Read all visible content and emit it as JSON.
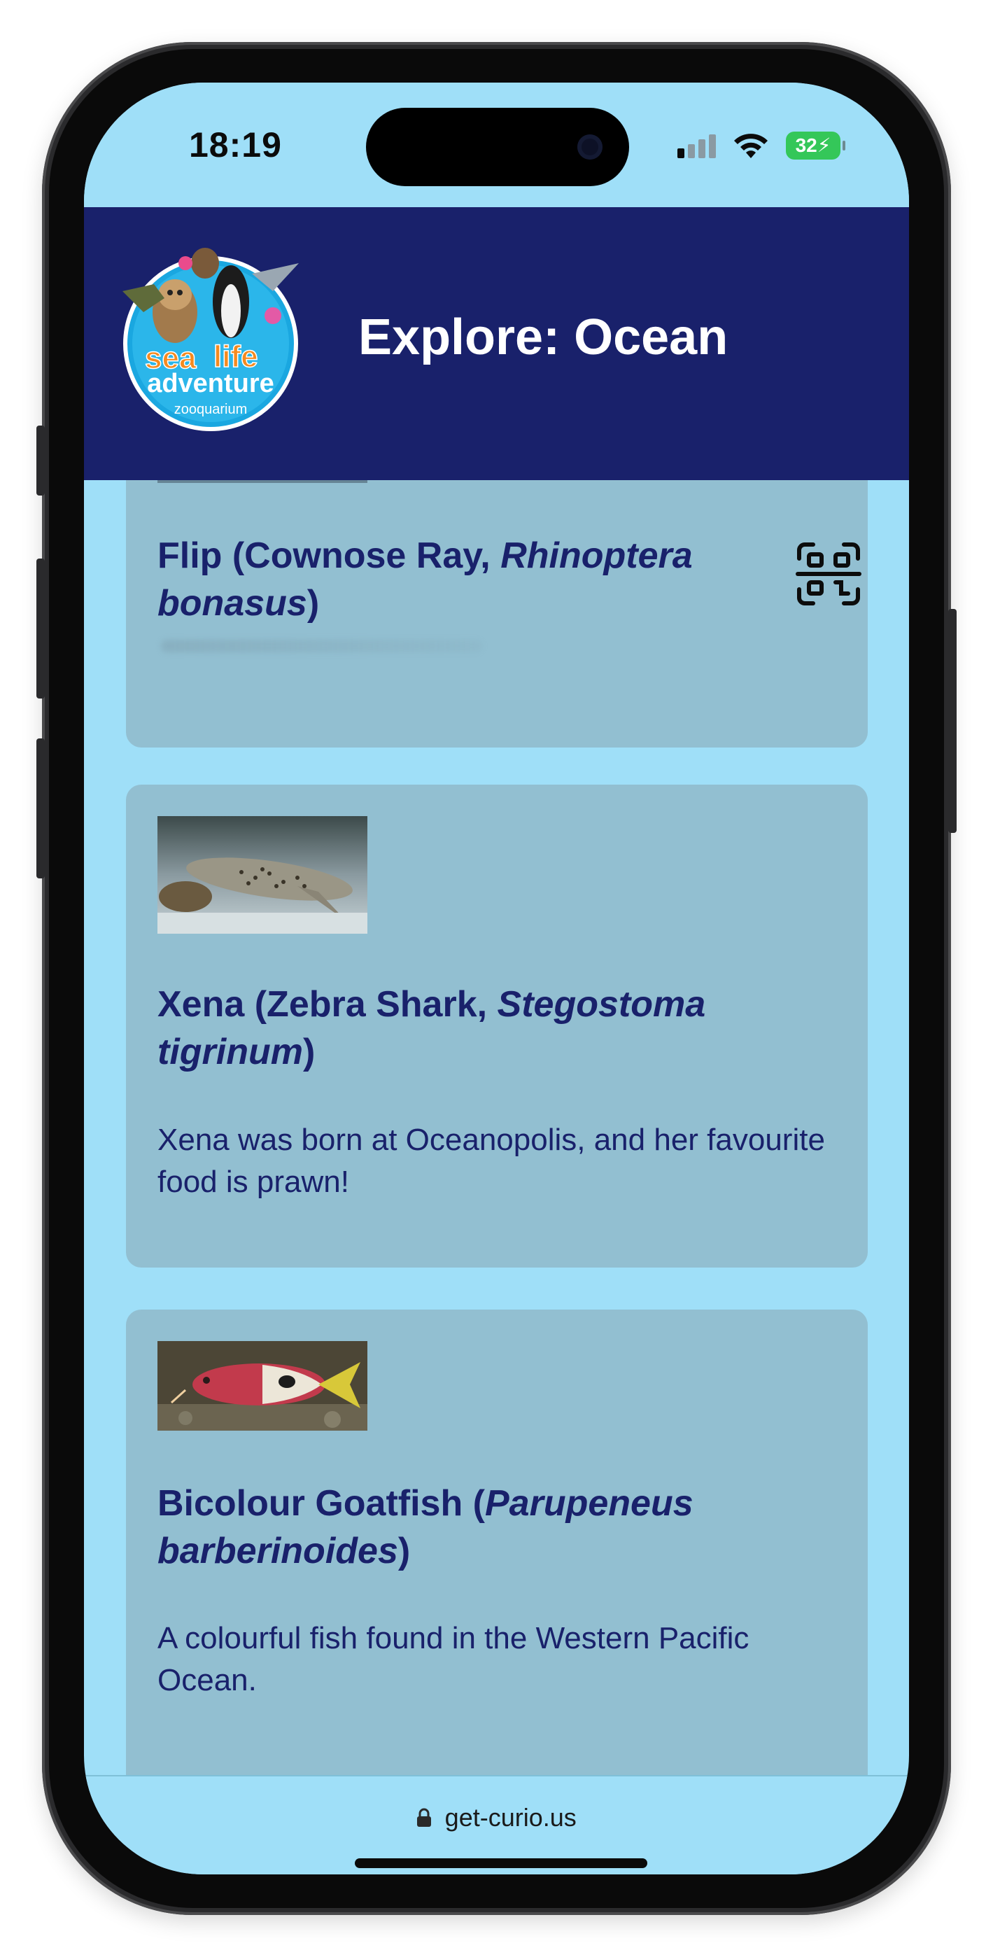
{
  "status_bar": {
    "time": "18:19",
    "battery": "32"
  },
  "header": {
    "logo_text": [
      "sea",
      "life",
      "adventure",
      "zooquarium"
    ],
    "title": "Explore: Ocean"
  },
  "cards": [
    {
      "title_plain": "Flip (Cownose Ray, ",
      "title_italic": "Rhinoptera bonasus",
      "title_close": ")",
      "action_icon": "qr-code-icon"
    },
    {
      "title_plain": "Xena (Zebra Shark, ",
      "title_italic": "Stegostoma tigrinum",
      "title_close": ")",
      "description": "Xena was born at Oceanopolis, and her favourite food is prawn!",
      "image_icon": "zebra-shark-photo"
    },
    {
      "title_plain": "Bicolour Goatfish (",
      "title_italic": "Parupeneus barberinoides",
      "title_close": ")",
      "description": "A colourful fish found in the Western Pacific Ocean.",
      "image_icon": "goatfish-photo"
    }
  ],
  "url_bar": {
    "url": "get-curio.us",
    "icon": "lock-icon"
  },
  "colors": {
    "page_bg": "#9fdff8",
    "header_bg": "#19216b",
    "card_bg": "#92bfd1",
    "text": "#19216b"
  }
}
